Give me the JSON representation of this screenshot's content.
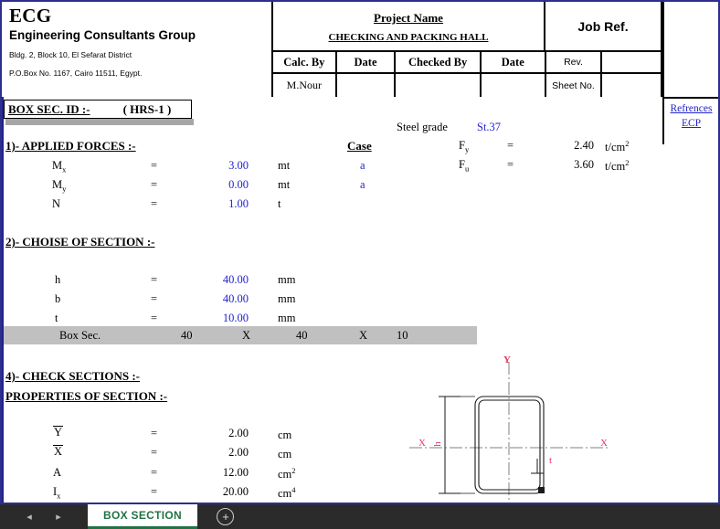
{
  "company": {
    "logo_text": "ECG",
    "name": "Engineering Consultants Group",
    "address_line1": "Bldg. 2, Block 10, El Sefarat District",
    "address_line2": "P.O.Box No. 1167, Cairo 11511, Egypt."
  },
  "header": {
    "project_name_label": "Project Name",
    "project_name_value": "CHECKING AND PACKING HALL",
    "job_ref_label": "Job Ref.",
    "calc_by_label": "Calc. By",
    "date_label_1": "Date",
    "checked_by_label": "Checked By",
    "date_label_2": "Date",
    "rev_label": "Rev.",
    "rev_value": "",
    "calc_by_value": "M.Nour",
    "date_value_1": "",
    "checked_by_value": "",
    "date_value_2": "",
    "sheet_no_label": "Sheet No.",
    "sheet_no_value": ""
  },
  "references": {
    "title": "Refrences",
    "link": "ECP"
  },
  "section_id": {
    "label": "BOX SEC. ID :-",
    "value": "( HRS-1 )"
  },
  "steel": {
    "grade_label": "Steel grade",
    "grade_value": "St.37",
    "fy_symbol": "F",
    "fy_sub": "y",
    "fy_eq": "=",
    "fy_value": "2.40",
    "fy_unit_base": "t/cm",
    "fy_unit_sup": "2",
    "fu_symbol": "F",
    "fu_sub": "u",
    "fu_eq": "=",
    "fu_value": "3.60",
    "fu_unit_base": "t/cm",
    "fu_unit_sup": "2"
  },
  "applied_forces": {
    "title": "1)- APPLIED FORCES :-",
    "case_header": "Case",
    "rows": [
      {
        "symbol": "M",
        "sub": "x",
        "eq": "=",
        "value": "3.00",
        "unit": "mt",
        "case": "a"
      },
      {
        "symbol": "M",
        "sub": "y",
        "eq": "=",
        "value": "0.00",
        "unit": "mt",
        "case": "a"
      },
      {
        "symbol": "N",
        "sub": "",
        "eq": "=",
        "value": "1.00",
        "unit": "t",
        "case": ""
      }
    ]
  },
  "choice_of_section": {
    "title": "2)- CHOISE OF SECTION :-",
    "rows": [
      {
        "symbol": "h",
        "eq": "=",
        "value": "40.00",
        "unit": "mm"
      },
      {
        "symbol": "b",
        "eq": "=",
        "value": "40.00",
        "unit": "mm"
      },
      {
        "symbol": "t",
        "eq": "=",
        "value": "10.00",
        "unit": "mm"
      }
    ],
    "summary": {
      "label": "Box Sec.",
      "dim1": "40",
      "x1": "X",
      "dim2": "40",
      "x2": "X",
      "dim3": "10"
    }
  },
  "check_sections": {
    "title": "4)- CHECK SECTIONS :-",
    "properties_title": "PROPERTIES OF SECTION :-",
    "rows": [
      {
        "symbol": "Y",
        "overbar": true,
        "sub": "",
        "eq": "=",
        "value": "2.00",
        "unit": "cm",
        "unit_sup": ""
      },
      {
        "symbol": "X",
        "overbar": true,
        "sub": "",
        "eq": "=",
        "value": "2.00",
        "unit": "cm",
        "unit_sup": ""
      },
      {
        "symbol": "A",
        "overbar": false,
        "sub": "",
        "eq": "=",
        "value": "12.00",
        "unit": "cm",
        "unit_sup": "2"
      },
      {
        "symbol": "I",
        "overbar": false,
        "sub": "x",
        "eq": "=",
        "value": "20.00",
        "unit": "cm",
        "unit_sup": "4"
      }
    ]
  },
  "diagram": {
    "axis_y_label": "Y",
    "axis_x_label_left": "X",
    "axis_x_label_right": "X",
    "height_label": "h",
    "thickness_label": "t",
    "accent_color": "#e8355e"
  },
  "tabbar": {
    "prev_arrow": "◂",
    "next_arrow": "▸",
    "active_tab": "BOX SECTION",
    "add_tab": "+"
  }
}
